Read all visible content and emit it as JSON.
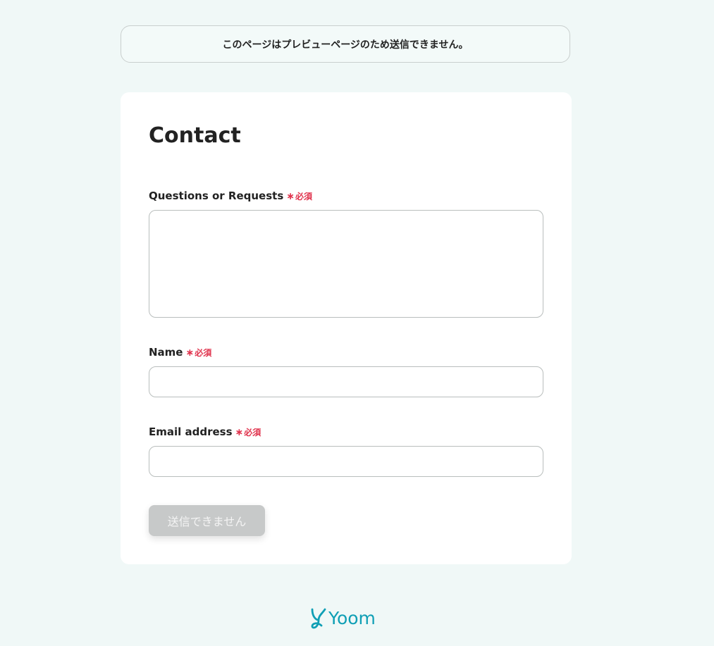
{
  "notice": {
    "text": "このページはプレビューページのため送信できません。"
  },
  "form": {
    "title": "Contact",
    "required_mark": "∗",
    "required_text": "必須",
    "fields": [
      {
        "label": "Questions or Requests",
        "value": "",
        "placeholder": ""
      },
      {
        "label": "Name",
        "value": "",
        "placeholder": ""
      },
      {
        "label": "Email address",
        "value": "",
        "placeholder": ""
      }
    ],
    "submit_label": "送信できません"
  },
  "footer": {
    "logo_text": "Yoom",
    "brand_color": "#0f9fb5"
  },
  "colors": {
    "background": "#f0f8f7",
    "card": "#ffffff",
    "required": "#e0334d",
    "disabled_button": "#c7c9c9"
  }
}
